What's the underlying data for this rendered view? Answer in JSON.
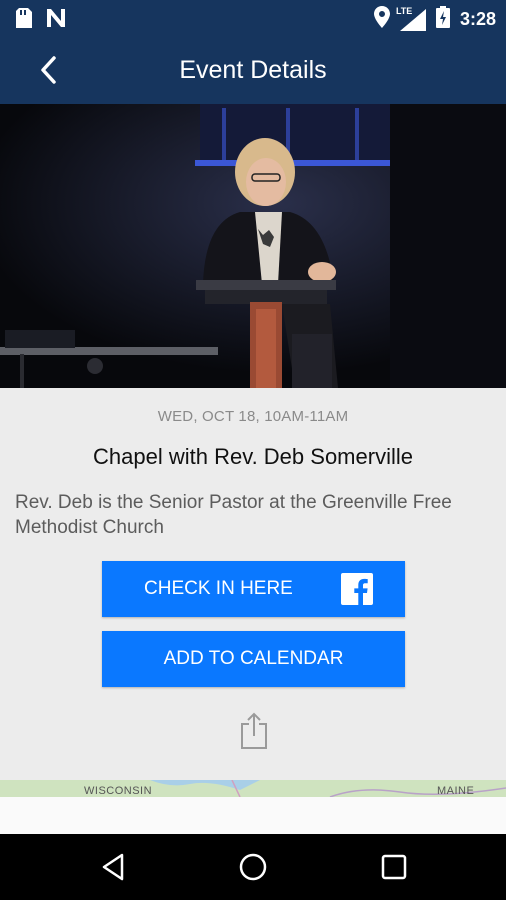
{
  "status_bar": {
    "time": "3:28",
    "network": "LTE",
    "icons": [
      "sd-card-icon",
      "n-notification-icon",
      "location-icon",
      "signal-icon",
      "battery-icon"
    ]
  },
  "app_bar": {
    "title": "Event Details",
    "back_icon": "chevron-left-icon"
  },
  "event": {
    "datetime": "WED, OCT 18, 10AM-11AM",
    "title": "Chapel with Rev. Deb Somerville",
    "description": "Rev. Deb is the Senior Pastor at the Greenville Free Methodist Church"
  },
  "buttons": {
    "check_in_label": "CHECK IN HERE",
    "check_in_icon": "facebook-icon",
    "add_calendar_label": "ADD TO CALENDAR",
    "share_icon": "share-icon"
  },
  "map": {
    "labels": [
      "WISCONSIN",
      "MAINE"
    ]
  },
  "colors": {
    "primary": "#16355e",
    "button": "#0a78ff",
    "background": "#ececec"
  },
  "nav_bar": {
    "icons": [
      "back-triangle-icon",
      "home-circle-icon",
      "recents-square-icon"
    ]
  }
}
